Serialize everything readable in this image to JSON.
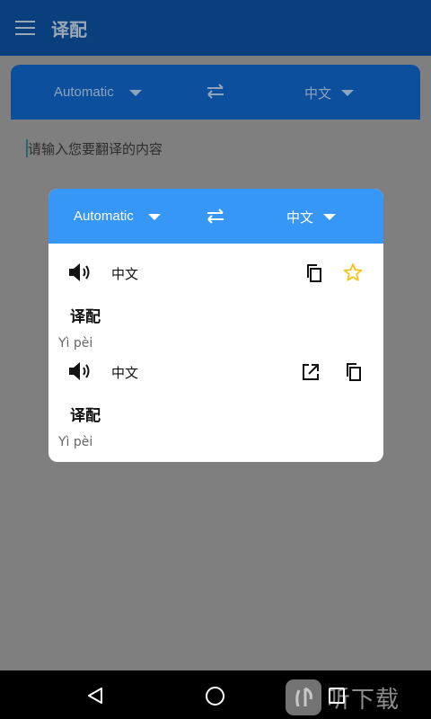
{
  "app": {
    "title": "译配"
  },
  "lang_bar": {
    "source": "Automatic",
    "target": "中文"
  },
  "input": {
    "placeholder": "请输入您要翻译的内容"
  },
  "dialog": {
    "source": "Automatic",
    "target": "中文",
    "results": [
      {
        "lang": "中文",
        "word": "译配",
        "pinyin": "Yì pèi",
        "icons": [
          "copy-icon",
          "star-icon"
        ]
      },
      {
        "lang": "中文",
        "word": "译配",
        "pinyin": "Yì pèi",
        "icons": [
          "open-external-icon",
          "copy-icon"
        ]
      }
    ]
  },
  "watermark": {
    "text": "听下载"
  },
  "colors": {
    "primary": "#3797f6",
    "star": "#f6c31c",
    "overlay": "#7f7f7f"
  }
}
